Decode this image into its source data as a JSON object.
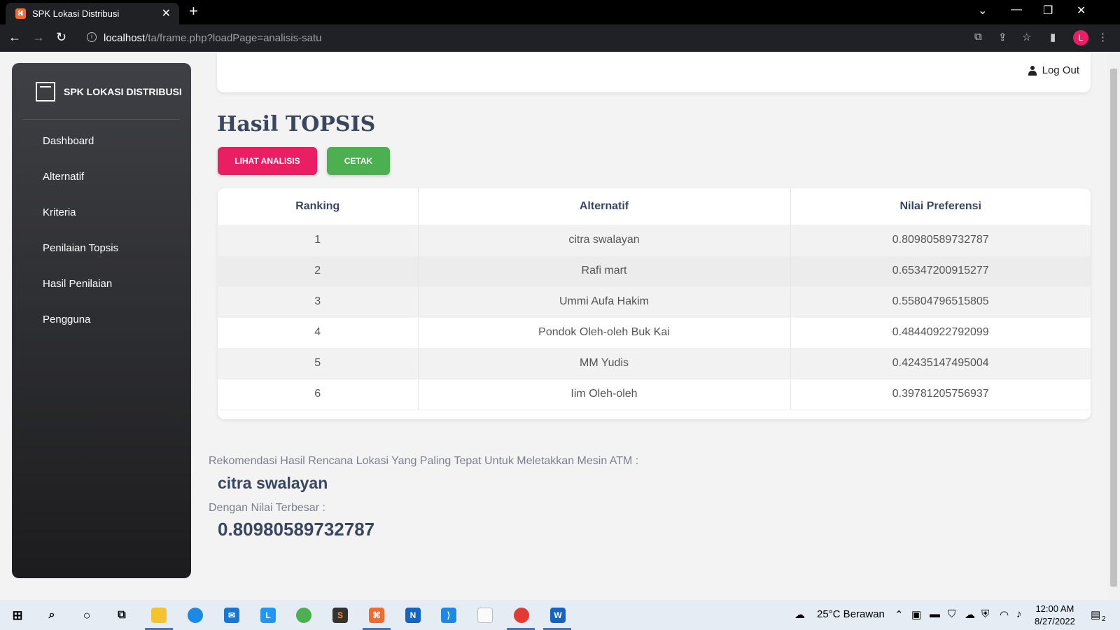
{
  "browser": {
    "tab_title": "SPK Lokasi Distribusi",
    "url_host": "localhost",
    "url_path": "/ta/frame.php?loadPage=analisis-satu",
    "avatar_letter": "L"
  },
  "sidebar": {
    "brand": "SPK LOKASI DISTRIBUSI",
    "items": [
      {
        "label": "Dashboard"
      },
      {
        "label": "Alternatif"
      },
      {
        "label": "Kriteria"
      },
      {
        "label": "Penilaian Topsis"
      },
      {
        "label": "Hasil Penilaian"
      },
      {
        "label": "Pengguna"
      }
    ]
  },
  "header": {
    "logout_label": "Log Out"
  },
  "main": {
    "title": "Hasil TOPSIS",
    "btn_analysis": "LIHAT ANALISIS",
    "btn_print": "CETAK",
    "table": {
      "columns": [
        "Ranking",
        "Alternatif",
        "Nilai Preferensi"
      ],
      "rows": [
        [
          "1",
          "citra swalayan",
          "0.80980589732787"
        ],
        [
          "2",
          "Rafi mart",
          "0.65347200915277"
        ],
        [
          "3",
          "Ummi Aufa Hakim",
          "0.55804796515805"
        ],
        [
          "4",
          "Pondok Oleh-oleh Buk Kai",
          "0.48440922792099"
        ],
        [
          "5",
          "MM Yudis",
          "0.42435147495004"
        ],
        [
          "6",
          "Iim Oleh-oleh",
          "0.39781205756937"
        ]
      ]
    },
    "recommend_label": "Rekomendasi Hasil Rencana Lokasi Yang Paling Tepat Untuk Meletakkan Mesin ATM :",
    "recommend_value": "citra swalayan",
    "best_label": "Dengan Nilai Terbesar :",
    "best_value": "0.80980589732787"
  },
  "taskbar": {
    "weather": "25°C  Berawan",
    "time": "12:00 AM",
    "date": "8/27/2022",
    "notif_count": "2"
  },
  "colors": {
    "accent_pink": "#e91e63",
    "accent_green": "#4caf50",
    "title": "#3a4660"
  }
}
